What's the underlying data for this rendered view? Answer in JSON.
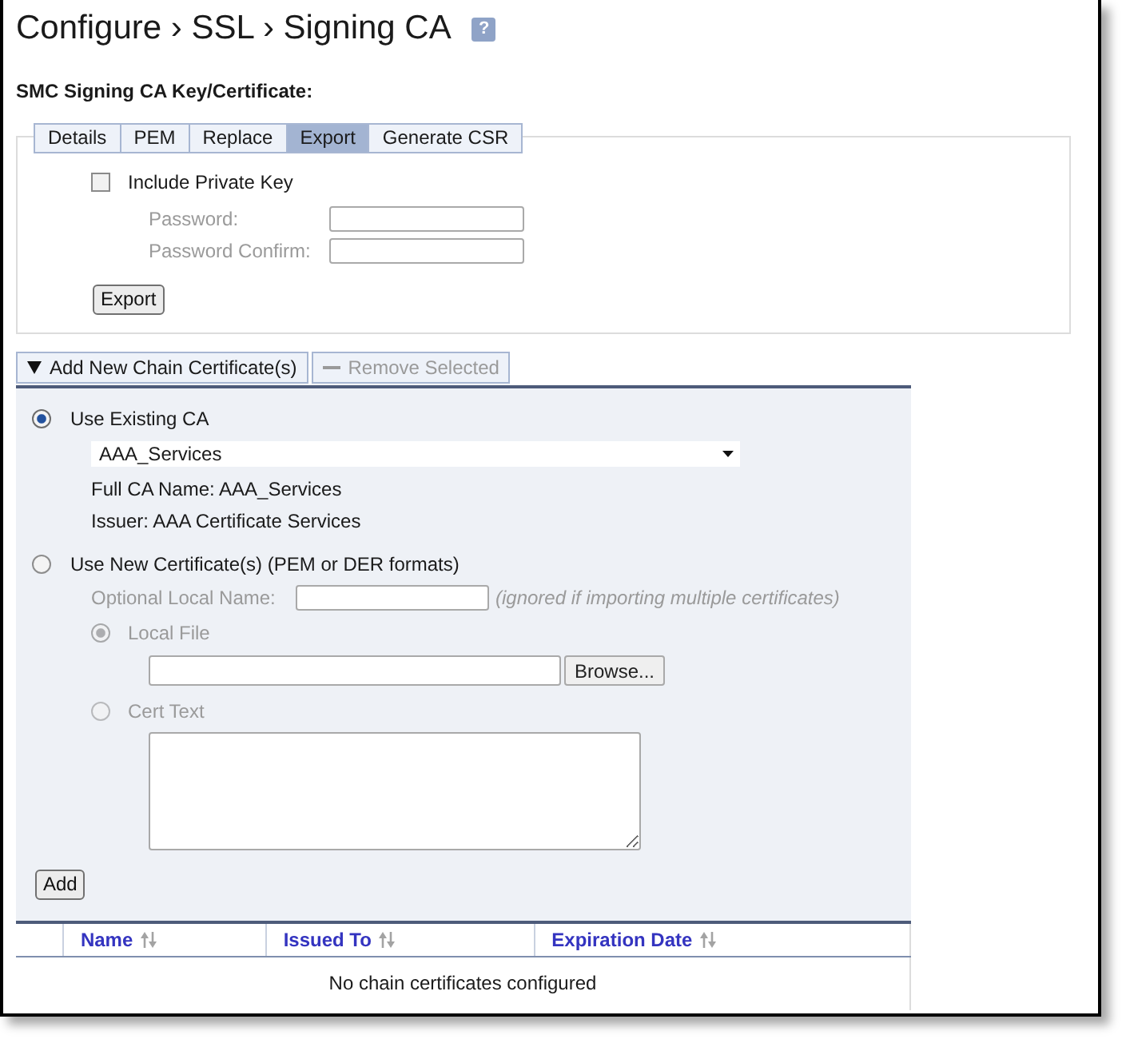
{
  "title": "Configure › SSL › Signing CA",
  "help": "?",
  "section_title": "SMC Signing CA Key/Certificate:",
  "tabs": [
    {
      "label": "Details",
      "selected": false
    },
    {
      "label": "PEM",
      "selected": false
    },
    {
      "label": "Replace",
      "selected": false
    },
    {
      "label": "Export",
      "selected": true
    },
    {
      "label": "Generate CSR",
      "selected": false
    }
  ],
  "export": {
    "include_private_key": {
      "label": "Include Private Key",
      "checked": false
    },
    "fields": [
      {
        "label": "Password:"
      },
      {
        "label": "Password Confirm:"
      }
    ],
    "button": "Export"
  },
  "toolbar": [
    {
      "kind": "toggle",
      "label": "Add New Chain Certificate(s)",
      "expanded": true
    },
    {
      "kind": "action",
      "label": "Remove Selected",
      "disabled": true
    }
  ],
  "chain": {
    "options": [
      {
        "kind": "existing",
        "label": "Use Existing CA",
        "selected": true,
        "ca_select": "AAA_Services",
        "details": [
          "Full CA Name: AAA_Services",
          "Issuer: AAA Certificate Services"
        ]
      },
      {
        "kind": "new",
        "label": "Use New Certificate(s) (PEM or DER formats)",
        "selected": false,
        "local_name": {
          "label": "Optional Local Name:",
          "note": "(ignored if importing multiple certificates)"
        },
        "sources": [
          {
            "kind": "file",
            "label": "Local File",
            "selected": true,
            "browse": "Browse..."
          },
          {
            "kind": "text",
            "label": "Cert Text",
            "selected": false
          }
        ]
      }
    ],
    "button": "Add"
  },
  "table": {
    "columns": [
      {
        "label": "Name",
        "sortable": true
      },
      {
        "label": "Issued To",
        "sortable": true
      },
      {
        "label": "Expiration Date",
        "sortable": true
      }
    ],
    "empty_text": "No chain certificates configured"
  }
}
